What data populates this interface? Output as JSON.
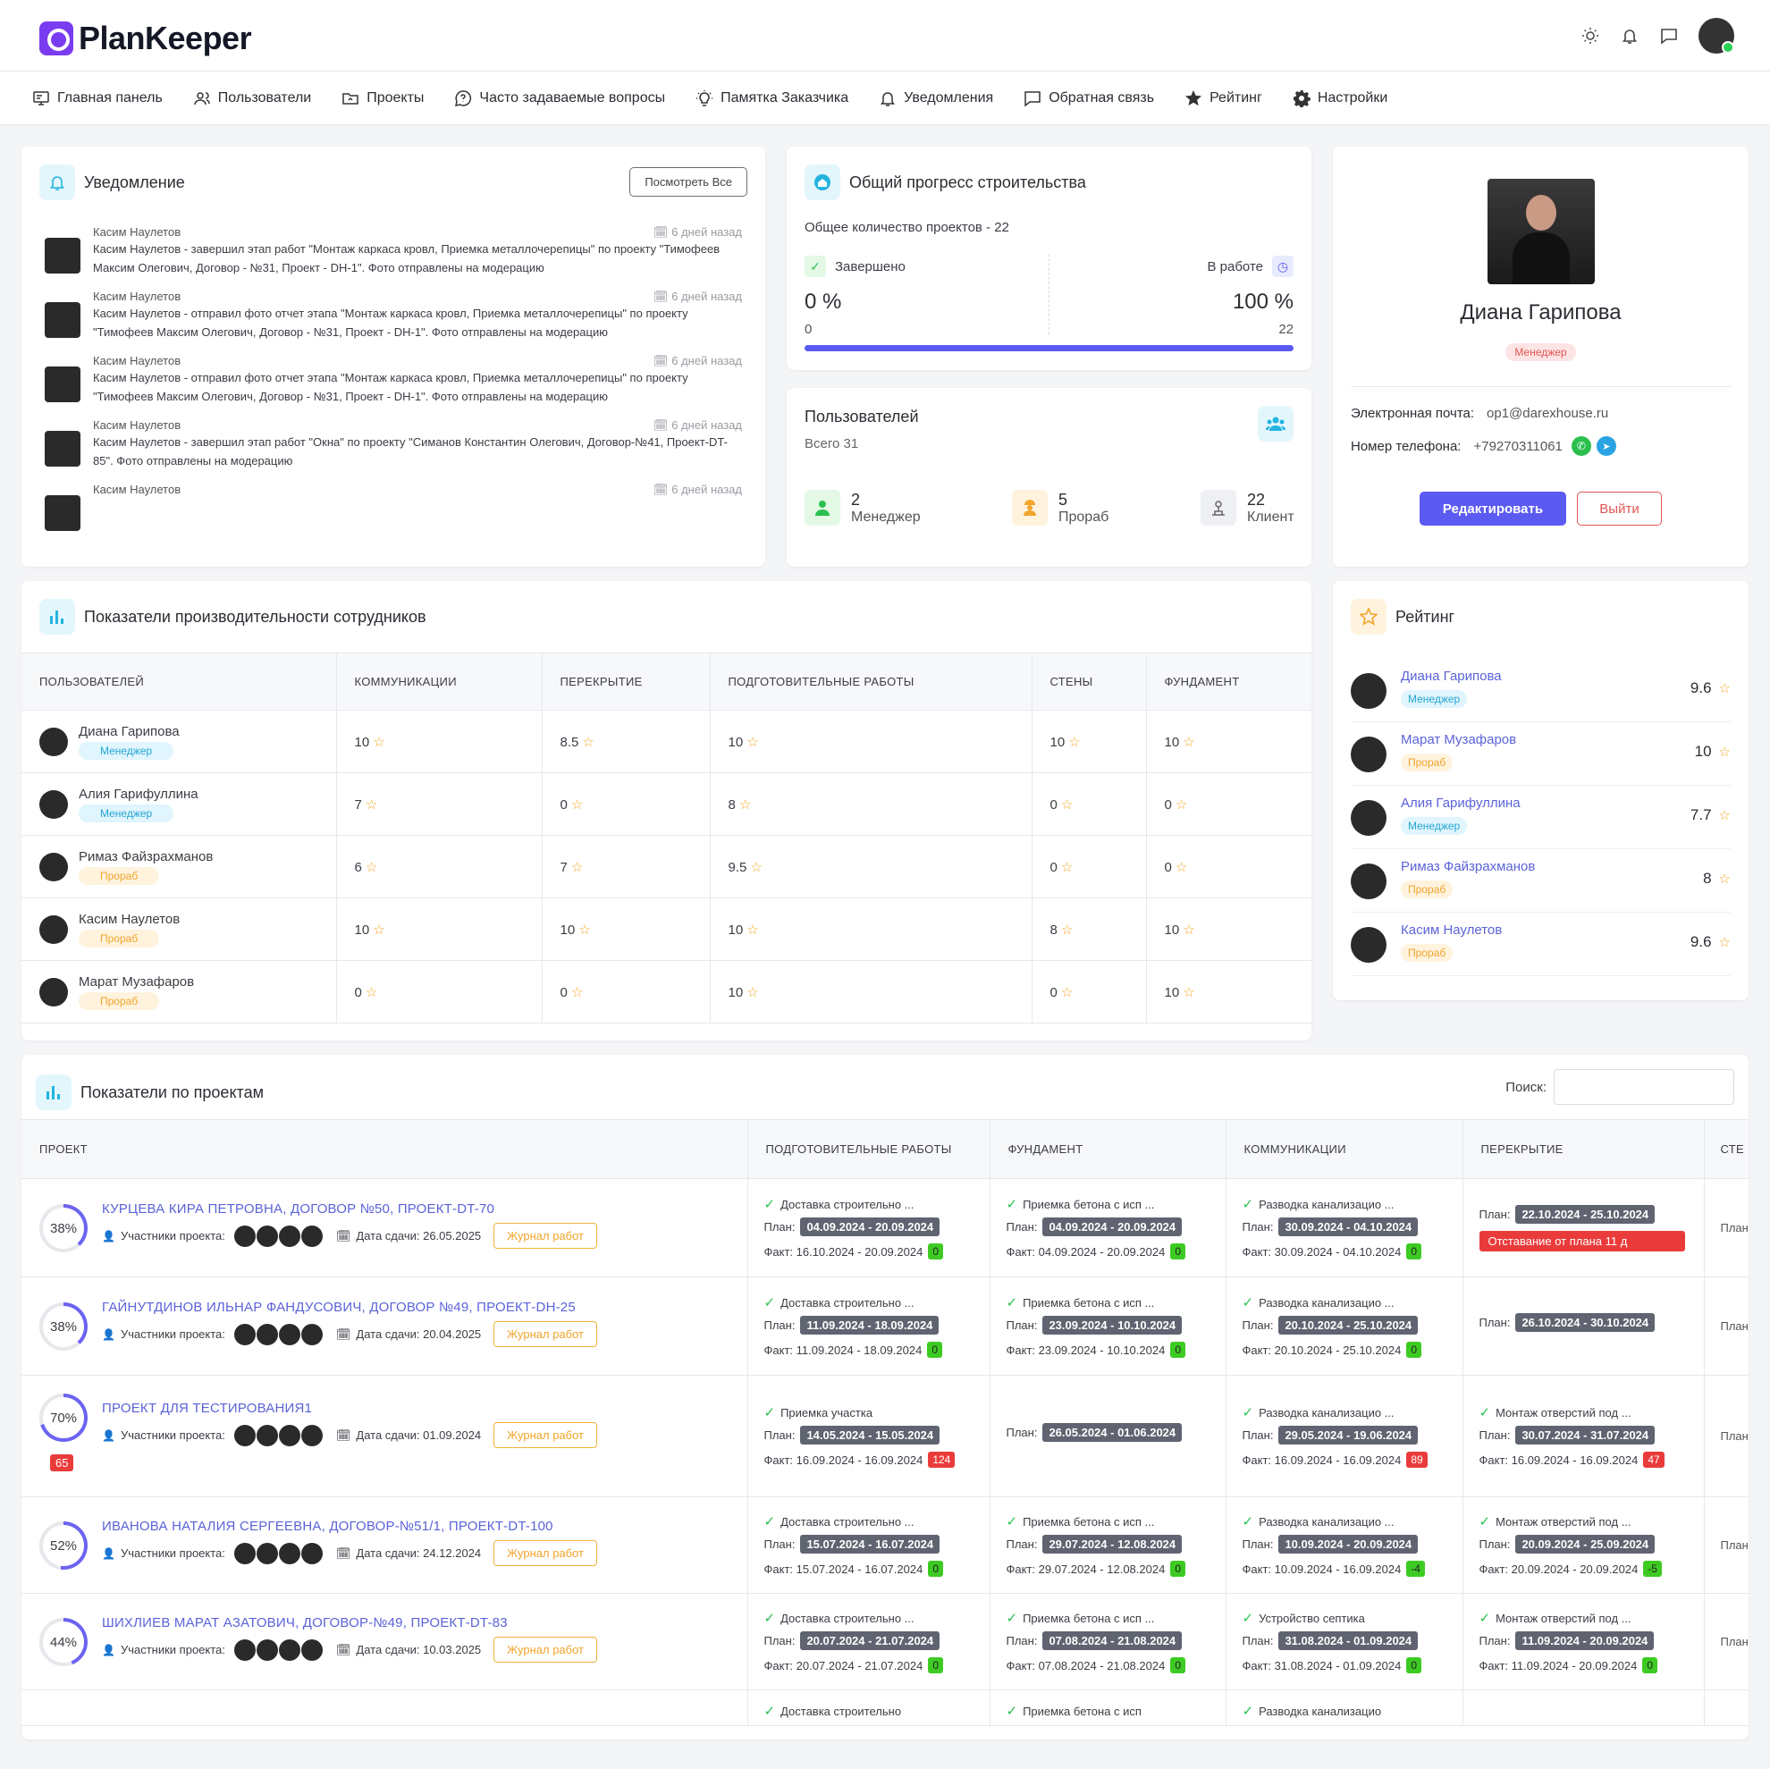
{
  "app": {
    "name": "PlanKeeper"
  },
  "nav": [
    "Главная панель",
    "Пользователи",
    "Проекты",
    "Часто задаваемые вопросы",
    "Памятка Заказчика",
    "Уведомления",
    "Обратная связь",
    "Рейтинг",
    "Настройки"
  ],
  "notifications": {
    "title": "Уведомление",
    "view_all": "Посмотреть Все",
    "items": [
      {
        "name": "Касим Наулетов",
        "time": "6 дней назад",
        "text": "Касим Наулетов - завершил этап работ \"Монтаж каркаса кровл, Приемка металлочерепицы\" по проекту \"Тимофеев Максим Олегович, Договор - №31, Проект - DH-1\". Фото отправлены на модерацию"
      },
      {
        "name": "Касим Наулетов",
        "time": "6 дней назад",
        "text": "Касим Наулетов - отправил фото отчет этапа \"Монтаж каркаса кровл, Приемка металлочерепицы\" по проекту \"Тимофеев Максим Олегович, Договор - №31, Проект - DH-1\". Фото отправлены на модерацию"
      },
      {
        "name": "Касим Наулетов",
        "time": "6 дней назад",
        "text": "Касим Наулетов - отправил фото отчет этапа \"Монтаж каркаса кровл, Приемка металлочерепицы\" по проекту \"Тимофеев Максим Олегович, Договор - №31, Проект - DH-1\". Фото отправлены на модерацию"
      },
      {
        "name": "Касим Наулетов",
        "time": "6 дней назад",
        "text": "Касим Наулетов - завершил этап работ \"Окна\" по проекту \"Симанов Константин Олегович, Договор-№41, Проект-DT-85\". Фото отправлены на модерацию"
      },
      {
        "name": "Касим Наулетов",
        "time": "6 дней назад",
        "text": ""
      }
    ]
  },
  "progress": {
    "title": "Общий прогресс строительства",
    "total": "Общее количество проектов - 22",
    "done_label": "Завершено",
    "done_pct": "0 %",
    "done_count": "0",
    "work_label": "В работе",
    "work_pct": "100 %",
    "work_count": "22",
    "work_fraction": 1.0
  },
  "users": {
    "title": "Пользователей",
    "total": "Всего 31",
    "stats": [
      {
        "num": "2",
        "label": "Менеджер"
      },
      {
        "num": "5",
        "label": "Прораб"
      },
      {
        "num": "22",
        "label": "Клиент"
      }
    ]
  },
  "profile": {
    "name": "Диана Гарипова",
    "role": "Менеджер",
    "email_label": "Электронная почта:",
    "email": "op1@darexhouse.ru",
    "phone_label": "Номер телефона:",
    "phone": "+79270311061",
    "edit": "Редактировать",
    "logout": "Выйти"
  },
  "perf": {
    "title": "Показатели производительности сотрудников",
    "headers": [
      "ПОЛЬЗОВАТЕЛЕЙ",
      "КОММУНИКАЦИИ",
      "ПЕРЕКРЫТИЕ",
      "ПОДГОТОВИТЕЛЬНЫЕ РАБОТЫ",
      "СТЕНЫ",
      "ФУНДАМЕНТ"
    ],
    "rows": [
      {
        "name": "Диана Гарипова",
        "role": "Менеджер",
        "vals": [
          "10",
          "8.5",
          "10",
          "10",
          "10"
        ]
      },
      {
        "name": "Алия Гарифуллина",
        "role": "Менеджер",
        "vals": [
          "7",
          "0",
          "8",
          "0",
          "0"
        ]
      },
      {
        "name": "Римаз Файзрахманов",
        "role": "Прораб",
        "vals": [
          "6",
          "7",
          "9.5",
          "0",
          "0"
        ]
      },
      {
        "name": "Касим Наулетов",
        "role": "Прораб",
        "vals": [
          "10",
          "10",
          "10",
          "8",
          "10"
        ]
      },
      {
        "name": "Марат Музафаров",
        "role": "Прораб",
        "vals": [
          "0",
          "0",
          "10",
          "0",
          "10"
        ]
      }
    ]
  },
  "rating": {
    "title": "Рейтинг",
    "rows": [
      {
        "name": "Диана Гарипова",
        "role": "Менеджер",
        "val": "9.6"
      },
      {
        "name": "Марат Музафаров",
        "role": "Прораб",
        "val": "10"
      },
      {
        "name": "Алия Гарифуллина",
        "role": "Менеджер",
        "val": "7.7"
      },
      {
        "name": "Римаз Файзрахманов",
        "role": "Прораб",
        "val": "8"
      },
      {
        "name": "Касим Наулетов",
        "role": "Прораб",
        "val": "9.6"
      }
    ]
  },
  "projects": {
    "title": "Показатели по проектам",
    "search_label": "Поиск:",
    "headers": [
      "ПРОЕКТ",
      "ПОДГОТОВИТЕЛЬНЫЕ РАБОТЫ",
      "ФУНДАМЕНТ",
      "КОММУНИКАЦИИ",
      "ПЕРЕКРЫТИЕ",
      "СТЕ"
    ],
    "members_label": "Участники проекта:",
    "journal": "Журнал работ",
    "plan_label": "План:",
    "rows": [
      {
        "pct": "38%",
        "pct_value": 0.38,
        "name": "КУРЦЕВА КИРА ПЕТРОВНА, ДОГОВОР №50, ПРОЕКТ-DT-70",
        "date": "Дата сдачи: 26.05.2025",
        "flag": "",
        "stages": [
          {
            "title": "Доставка строительно ...",
            "plan": "04.09.2024 - 20.09.2024",
            "fact": "Факт: 16.10.2024 - 20.09.2024",
            "num": "0",
            "neg": false
          },
          {
            "title": "Приемка бетона с исп ...",
            "plan": "04.09.2024 - 20.09.2024",
            "fact": "Факт: 04.09.2024 - 20.09.2024",
            "num": "0",
            "neg": false
          },
          {
            "title": "Разводка канализацио ...",
            "plan": "30.09.2024 - 04.10.2024",
            "fact": "Факт: 30.09.2024 - 04.10.2024",
            "num": "0",
            "neg": false
          },
          {
            "title": "",
            "plan": "22.10.2024 - 25.10.2024",
            "fact": "",
            "num": "",
            "neg": false,
            "lag": "Отставание от плана 11 д"
          }
        ]
      },
      {
        "pct": "38%",
        "pct_value": 0.38,
        "name": "ГАЙНУТДИНОВ ИЛЬНАР ФАНДУСОВИЧ, ДОГОВОР №49, ПРОЕКТ-DH-25",
        "date": "Дата сдачи: 20.04.2025",
        "flag": "",
        "stages": [
          {
            "title": "Доставка строительно ...",
            "plan": "11.09.2024 - 18.09.2024",
            "fact": "Факт: 11.09.2024 - 18.09.2024",
            "num": "0",
            "neg": false
          },
          {
            "title": "Приемка бетона с исп ...",
            "plan": "23.09.2024 - 10.10.2024",
            "fact": "Факт: 23.09.2024 - 10.10.2024",
            "num": "0",
            "neg": false
          },
          {
            "title": "Разводка канализацио ...",
            "plan": "20.10.2024 - 25.10.2024",
            "fact": "Факт: 20.10.2024 - 25.10.2024",
            "num": "0",
            "neg": false
          },
          {
            "title": "",
            "plan": "26.10.2024 - 30.10.2024",
            "fact": "",
            "num": "",
            "neg": false
          }
        ]
      },
      {
        "pct": "70%",
        "pct_value": 0.7,
        "name": "ПРОЕКТ ДЛЯ ТЕСТИРОВАНИЯ1",
        "date": "Дата сдачи: 01.09.2024",
        "flag": "65",
        "stages": [
          {
            "title": "Приемка участка",
            "plan": "14.05.2024 - 15.05.2024",
            "fact": "Факт: 16.09.2024 - 16.09.2024",
            "num": "124",
            "neg": true
          },
          {
            "title": "",
            "plan": "26.05.2024 - 01.06.2024",
            "fact": "",
            "num": "",
            "neg": false
          },
          {
            "title": "Разводка канализацио ...",
            "plan": "29.05.2024 - 19.06.2024",
            "fact": "Факт: 16.09.2024 - 16.09.2024",
            "num": "89",
            "neg": true
          },
          {
            "title": "Монтаж отверстий под ...",
            "plan": "30.07.2024 - 31.07.2024",
            "fact": "Факт: 16.09.2024 - 16.09.2024",
            "num": "47",
            "neg": true
          }
        ]
      },
      {
        "pct": "52%",
        "pct_value": 0.52,
        "name": "ИВАНОВА НАТАЛИЯ СЕРГЕЕВНА, ДОГОВОР-№51/1, ПРОЕКТ-DT-100",
        "date": "Дата сдачи: 24.12.2024",
        "flag": "",
        "stages": [
          {
            "title": "Доставка строительно ...",
            "plan": "15.07.2024 - 16.07.2024",
            "fact": "Факт: 15.07.2024 - 16.07.2024",
            "num": "0",
            "neg": false
          },
          {
            "title": "Приемка бетона с исп ...",
            "plan": "29.07.2024 - 12.08.2024",
            "fact": "Факт: 29.07.2024 - 12.08.2024",
            "num": "0",
            "neg": false
          },
          {
            "title": "Разводка канализацио ...",
            "plan": "10.09.2024 - 20.09.2024",
            "fact": "Факт: 10.09.2024 - 16.09.2024",
            "num": "-4",
            "neg": false
          },
          {
            "title": "Монтаж отверстий под ...",
            "plan": "20.09.2024 - 25.09.2024",
            "fact": "Факт: 20.09.2024 - 20.09.2024",
            "num": "-5",
            "neg": false
          }
        ]
      },
      {
        "pct": "44%",
        "pct_value": 0.44,
        "name": "ШИХЛИЕВ МАРАТ АЗАТОВИЧ, ДОГОВОР-№49, ПРОЕКТ-DT-83",
        "date": "Дата сдачи: 10.03.2025",
        "flag": "",
        "stages": [
          {
            "title": "Доставка строительно ...",
            "plan": "20.07.2024 - 21.07.2024",
            "fact": "Факт: 20.07.2024 - 21.07.2024",
            "num": "0",
            "neg": false
          },
          {
            "title": "Приемка бетона с исп ...",
            "plan": "07.08.2024 - 21.08.2024",
            "fact": "Факт: 07.08.2024 - 21.08.2024",
            "num": "0",
            "neg": false
          },
          {
            "title": "Устройство септика",
            "plan": "31.08.2024 - 01.09.2024",
            "fact": "Факт: 31.08.2024 - 01.09.2024",
            "num": "0",
            "neg": false
          },
          {
            "title": "Монтаж отверстий под ...",
            "plan": "11.09.2024 - 20.09.2024",
            "fact": "Факт: 11.09.2024 - 20.09.2024",
            "num": "0",
            "neg": false
          }
        ]
      }
    ],
    "tail_stages": [
      "Доставка строительно",
      "Приемка бетона с исп",
      "Разводка канализацио"
    ],
    "cut_plan": "План"
  }
}
